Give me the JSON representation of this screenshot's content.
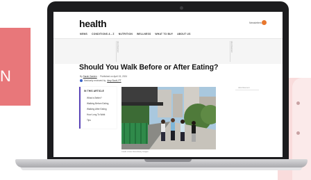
{
  "decor": {
    "left_panel_letter": "N"
  },
  "site": {
    "logo": "health",
    "nav": [
      "NEWS",
      "CONDITIONS A - Z",
      "NUTRITION",
      "WELLNESS",
      "WHAT TO BUY",
      "ABOUT US"
    ],
    "newsletter_label": "Newsletters",
    "ad_label": "Advertisement"
  },
  "article": {
    "title": "Should You Walk Before or After Eating?",
    "byline_prefix": "By",
    "author": "Sarah Garden",
    "published": "Published on April 15, 2024",
    "reviewed_prefix": "Medically reviewed by",
    "reviewer": "Amy Scott, PT",
    "toc_title": "IN THIS ARTICLE",
    "toc_items": [
      "What is Better?",
      "Walking Before Eating",
      "Walking After Eating",
      "How Long To Walk",
      "Tips"
    ],
    "photo_caption": "Credit: Annie Otzen/Getty Images"
  },
  "colors": {
    "accent": "#5b45b8",
    "brand_orange": "#e8772e",
    "deco_red": "#e8777a",
    "deco_pink": "#f9dcdc"
  }
}
